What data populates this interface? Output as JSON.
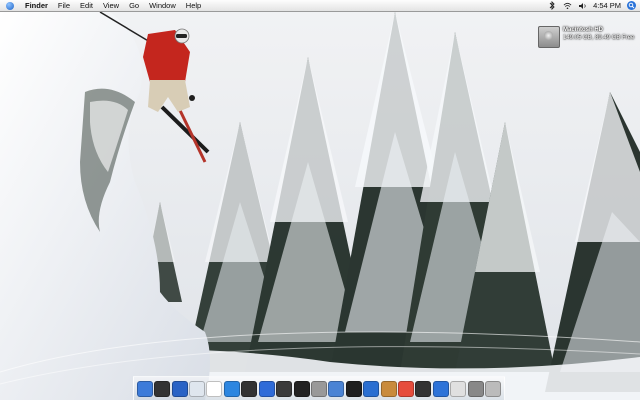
{
  "menubar": {
    "apple_icon": "apple-logo-icon",
    "items": [
      "Finder",
      "File",
      "Edit",
      "View",
      "Go",
      "Window",
      "Help"
    ],
    "clock": "4:54 PM",
    "status_icons": [
      "bluetooth-icon",
      "wifi-icon",
      "volume-icon",
      "spotlight-icon"
    ]
  },
  "desktop": {
    "hard_drive": {
      "name": "Macintosh HD",
      "info": "149.05 GB, 89.49 GB Free",
      "icon": "hard-drive-icon"
    }
  },
  "dock": {
    "items": [
      {
        "name": "finder-icon",
        "color": "#3d7bd9"
      },
      {
        "name": "dashboard-icon",
        "color": "#333333"
      },
      {
        "name": "mail-icon",
        "color": "#2a63c5"
      },
      {
        "name": "safari-icon",
        "color": "#dfe6ee"
      },
      {
        "name": "ical-icon",
        "color": "#ffffff"
      },
      {
        "name": "ichat-icon",
        "color": "#2c86e0"
      },
      {
        "name": "quicktime-icon",
        "color": "#333333"
      },
      {
        "name": "itunes-icon",
        "color": "#2f6bd8"
      },
      {
        "name": "iphoto-icon",
        "color": "#3b3b3b"
      },
      {
        "name": "dvd-player-icon",
        "color": "#222222"
      },
      {
        "name": "preview-icon",
        "color": "#999999"
      },
      {
        "name": "xcode-icon",
        "color": "#4a83d4"
      },
      {
        "name": "terminal-icon",
        "color": "#1f1f1f"
      },
      {
        "name": "system-preferences-icon",
        "color": "#2a6fd1"
      },
      {
        "name": "address-book-icon",
        "color": "#c98b3c"
      },
      {
        "name": "calendar-icon",
        "color": "#e64c3c"
      },
      {
        "name": "app-icon",
        "color": "#333333"
      },
      {
        "name": "network-icon",
        "color": "#2d73d8"
      },
      {
        "name": "folder-icon",
        "color": "#e0e0e0"
      },
      {
        "name": "documents-icon",
        "color": "#888888"
      },
      {
        "name": "trash-icon",
        "color": "#bbbbbb"
      }
    ]
  }
}
